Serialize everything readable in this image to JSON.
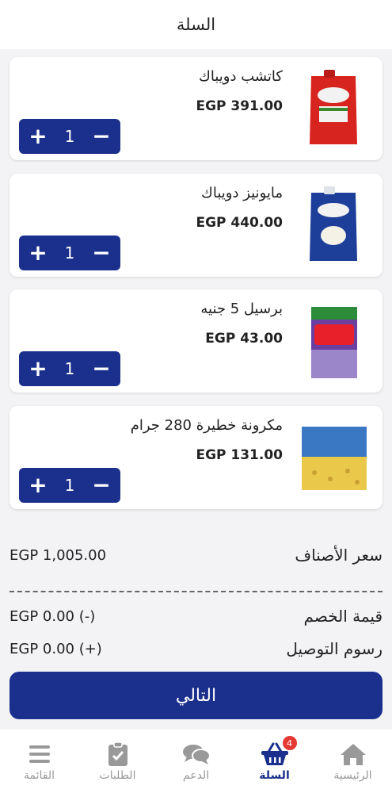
{
  "header": {
    "title": "السلة"
  },
  "cart": {
    "items": [
      {
        "name": "كاتشب دويباك",
        "price": "EGP 391.00",
        "qty": "1",
        "image": "heinz-ketchup-pouch"
      },
      {
        "name": "مايونيز دويباك",
        "price": "EGP 440.00",
        "qty": "1",
        "image": "heinz-mayonnaise-pouch"
      },
      {
        "name": "برسيل 5 جنيه",
        "price": "EGP 43.00",
        "qty": "1",
        "image": "persil-detergent-pack"
      },
      {
        "name": "مكرونة خطيرة 280 جرام",
        "price": "EGP 131.00",
        "qty": "1",
        "image": "khateera-pasta-bag"
      }
    ],
    "stepper": {
      "plus": "+",
      "minus": "−"
    }
  },
  "summary": {
    "items_label": "سعر الأصناف",
    "items_value": "EGP 1,005.00",
    "discount_label": "قيمة الخصم",
    "discount_value": "EGP 0.00 (-)",
    "delivery_label": "رسوم التوصيل",
    "delivery_value": "EGP 0.00 (+)"
  },
  "next_button": {
    "label": "التالي"
  },
  "nav": {
    "items": [
      {
        "label": "القائمة",
        "icon": "menu-icon"
      },
      {
        "label": "الطلبات",
        "icon": "clipboard-check-icon"
      },
      {
        "label": "الدعم",
        "icon": "chat-bubbles-icon"
      },
      {
        "label": "السلة",
        "icon": "basket-icon",
        "badge": "4",
        "active": true
      },
      {
        "label": "الرئيسية",
        "icon": "home-icon"
      }
    ]
  },
  "colors": {
    "primary": "#1b2f8c",
    "badge": "#e53935",
    "background": "#f3f3f5"
  }
}
